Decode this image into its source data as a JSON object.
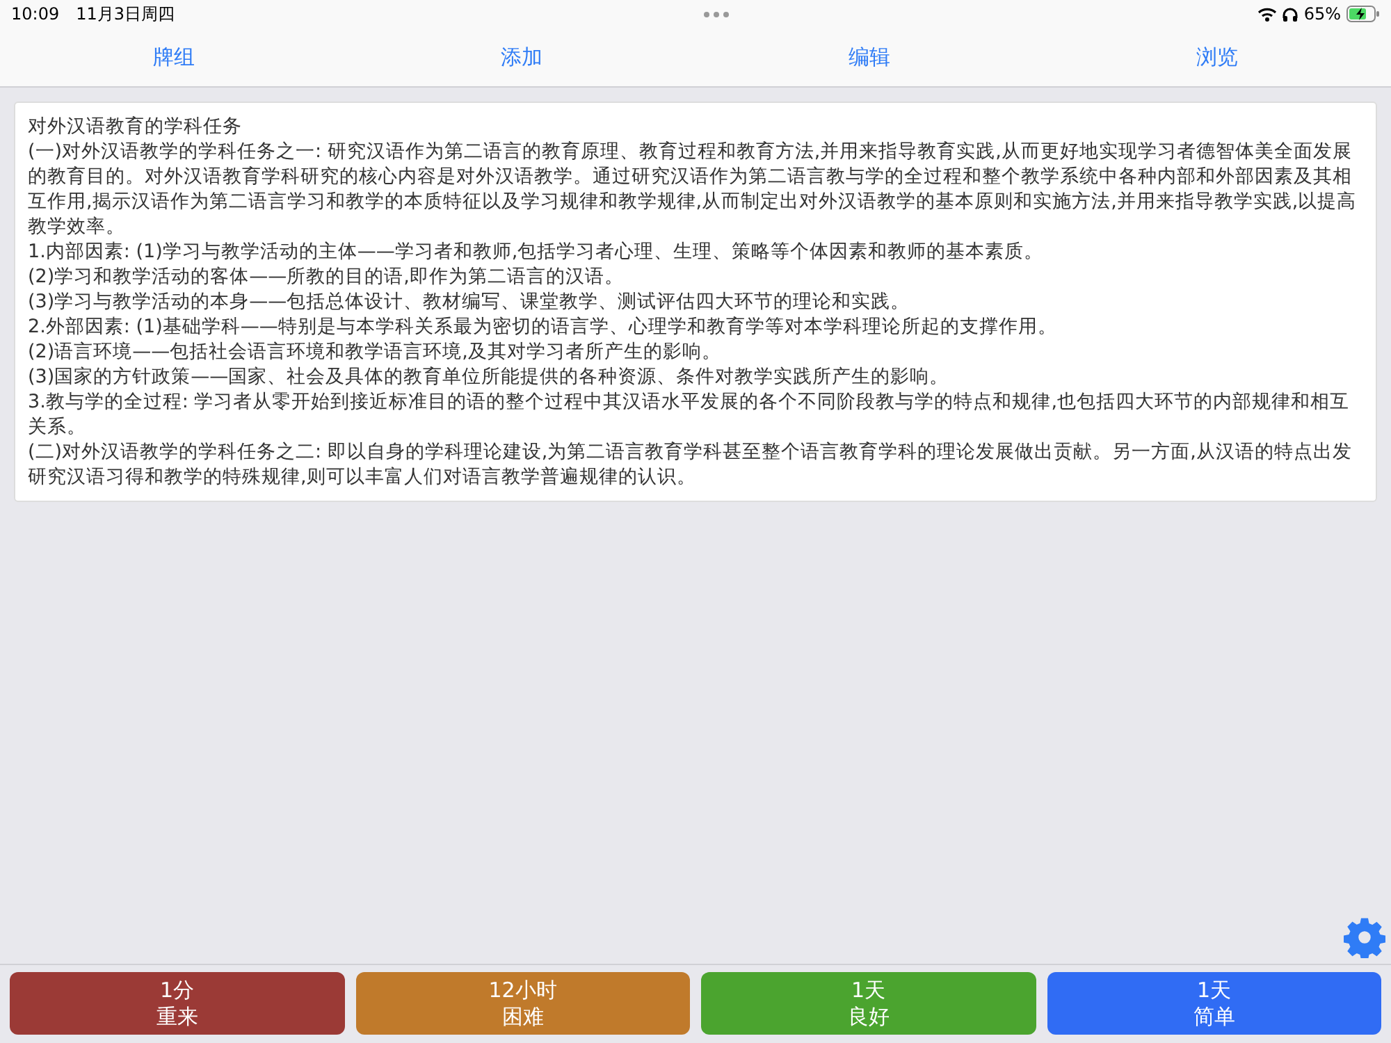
{
  "status_bar": {
    "time": "10:09",
    "date": "11月3日周四",
    "battery": "65%"
  },
  "toolbar": {
    "items": [
      {
        "label": "牌组"
      },
      {
        "label": "添加"
      },
      {
        "label": "编辑"
      },
      {
        "label": "浏览"
      }
    ]
  },
  "card": {
    "title": "对外汉语教育的学科任务",
    "paragraphs": [
      "(一)对外汉语教学的学科任务之一: 研究汉语作为第二语言的教育原理、教育过程和教育方法,并用来指导教育实践,从而更好地实现学习者德智体美全面发展的教育目的。对外汉语教育学科研究的核心内容是对外汉语教学。通过研究汉语作为第二语言教与学的全过程和整个教学系统中各种内部和外部因素及其相互作用,揭示汉语作为第二语言学习和教学的本质特征以及学习规律和教学规律,从而制定出对外汉语教学的基本原则和实施方法,并用来指导教学实践,以提高教学效率。",
      "1.内部因素: (1)学习与教学活动的主体——学习者和教师,包括学习者心理、生理、策略等个体因素和教师的基本素质。",
      "(2)学习和教学活动的客体——所教的目的语,即作为第二语言的汉语。",
      "(3)学习与教学活动的本身——包括总体设计、教材编写、课堂教学、测试评估四大环节的理论和实践。",
      "2.外部因素: (1)基础学科——特别是与本学科关系最为密切的语言学、心理学和教育学等对本学科理论所起的支撑作用。",
      "(2)语言环境——包括社会语言环境和教学语言环境,及其对学习者所产生的影响。",
      "(3)国家的方针政策——国家、社会及具体的教育单位所能提供的各种资源、条件对教学实践所产生的影响。",
      "3.教与学的全过程: 学习者从零开始到接近标准目的语的整个过程中其汉语水平发展的各个不同阶段教与学的特点和规律,也包括四大环节的内部规律和相互关系。",
      "(二)对外汉语教学的学科任务之二: 即以自身的学科理论建设,为第二语言教育学科甚至整个语言教育学科的理论发展做出贡献。另一方面,从汉语的特点出发研究汉语习得和教学的特殊规律,则可以丰富人们对语言教学普遍规律的认识。"
    ]
  },
  "answer_buttons": [
    {
      "interval": "1分",
      "label": "重来",
      "color": "#9b3a36"
    },
    {
      "interval": "12小时",
      "label": "困难",
      "color": "#c07a2b"
    },
    {
      "interval": "1天",
      "label": "良好",
      "color": "#4ba42f"
    },
    {
      "interval": "1天",
      "label": "简单",
      "color": "#306cf4"
    }
  ]
}
